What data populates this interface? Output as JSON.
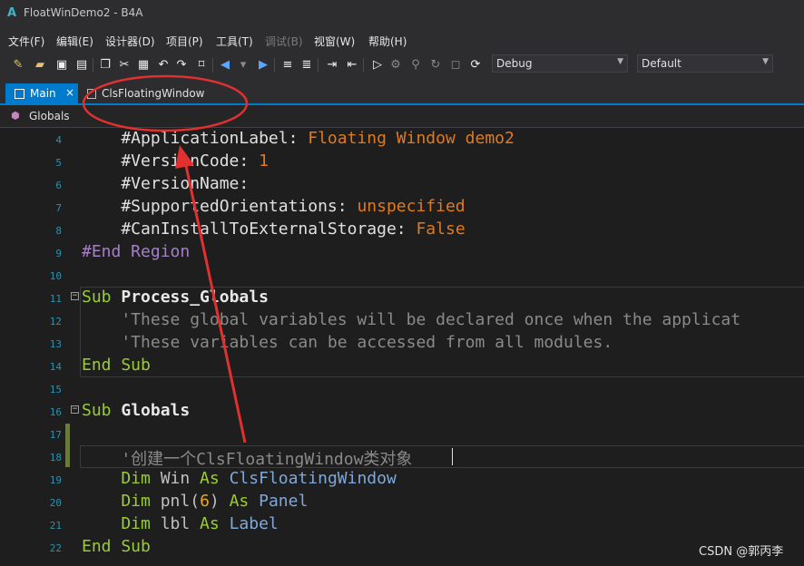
{
  "window": {
    "title": "FloatWinDemo2 - B4A",
    "app_icon": "A"
  },
  "menu": [
    {
      "label": "文件(F)",
      "enabled": true
    },
    {
      "label": "编辑(E)",
      "enabled": true
    },
    {
      "label": "设计器(D)",
      "enabled": true
    },
    {
      "label": "项目(P)",
      "enabled": true
    },
    {
      "label": "工具(T)",
      "enabled": true
    },
    {
      "label": "调试(B)",
      "enabled": false
    },
    {
      "label": "视窗(W)",
      "enabled": true
    },
    {
      "label": "帮助(H)",
      "enabled": true
    }
  ],
  "toolbar": {
    "build_config": "Debug",
    "device_config": "Default",
    "icons": [
      "magic-wand-icon",
      "open-folder-icon",
      "save-icon",
      "save-all-icon",
      "copy-icon",
      "cut-icon",
      "paste-icon",
      "undo-icon",
      "redo-icon",
      "bookmark-icon",
      "back-icon",
      "forward-icon",
      "comment-icon",
      "uncomment-icon",
      "indent-icon",
      "outdent-icon",
      "run-icon",
      "step-icon",
      "pause-icon",
      "stop-icon",
      "restart-icon"
    ]
  },
  "tabs": {
    "active": {
      "label": "Main",
      "close": "×"
    },
    "other": {
      "label": "ClsFloatingWindow"
    }
  },
  "navbar": {
    "label": "Globals"
  },
  "code_lines": [
    {
      "n": "4"
    },
    {
      "n": "5"
    },
    {
      "n": "6"
    },
    {
      "n": "7"
    },
    {
      "n": "8"
    },
    {
      "n": "9"
    },
    {
      "n": "10"
    },
    {
      "n": "11"
    },
    {
      "n": "12"
    },
    {
      "n": "13"
    },
    {
      "n": "14"
    },
    {
      "n": "15"
    },
    {
      "n": "16"
    },
    {
      "n": "17"
    },
    {
      "n": "18"
    },
    {
      "n": "19"
    },
    {
      "n": "20"
    },
    {
      "n": "21"
    },
    {
      "n": "22"
    }
  ],
  "code": {
    "l4a": "    #ApplicationLabel: ",
    "l4b": "Floating Window demo2",
    "l5a": "    #VersionCode: ",
    "l5b": "1",
    "l6a": "    #VersionName:",
    "l7a": "    #SupportedOrientations: ",
    "l7b": "unspecified",
    "l8a": "    #CanInstallToExternalStorage: ",
    "l8b": "False",
    "l9a": "#End Region",
    "l11a": "Sub ",
    "l11b": "Process_Globals",
    "l12a": "    'These global variables will be declared once when the applicat",
    "l13a": "    'These variables can be accessed from all modules.",
    "l14a": "End Sub",
    "l16a": "Sub ",
    "l16b": "Globals",
    "l18a": "    '创建一个ClsFloatingWindow类对象",
    "l19_dim": "    Dim ",
    "l19_var": "Win",
    "l19_as": " As ",
    "l19_type": "ClsFloatingWindow",
    "l20_dim": "    Dim ",
    "l20_var": "pnl(",
    "l20_num": "6",
    "l20_close": ")",
    "l20_as": " As ",
    "l20_type": "Panel",
    "l21_dim": "    Dim ",
    "l21_var": "lbl",
    "l21_as": " As ",
    "l21_type": "Label",
    "l22a": "End Sub"
  },
  "watermark": "CSDN @郭丙李",
  "colors": {
    "accent": "#007acc",
    "annotation": "#e03030"
  }
}
